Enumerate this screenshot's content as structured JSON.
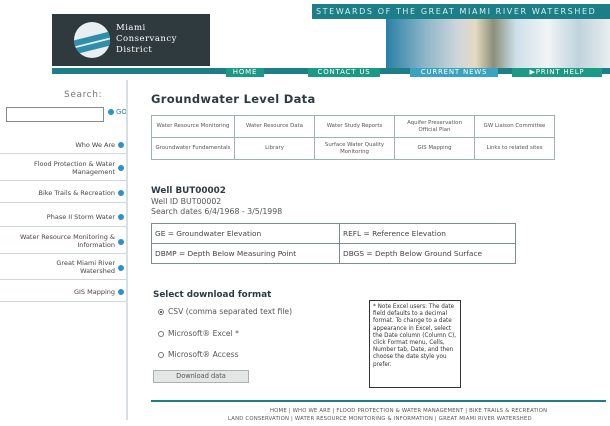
{
  "header": {
    "tagline": "STEWARDS OF THE GREAT MIAMI RIVER WATERSHED",
    "logo_lines": [
      "Miami",
      "Conservancy",
      "District"
    ],
    "nav": [
      "HOME",
      "CONTACT US",
      "CURRENT NEWS",
      "▶PRINT HELP"
    ]
  },
  "sidebar": {
    "search_label": "Search:",
    "search_value": "",
    "go_label": "GO",
    "items": [
      "Who We Are",
      "Flood Protection & Water Management",
      "Bike Trails & Recreation",
      "Phase II Storm Water",
      "Water Resource Monitoring & Information",
      "Great Miami River Watershed",
      "GIS Mapping"
    ]
  },
  "main": {
    "title": "Groundwater Level Data",
    "link_grid": [
      [
        "Water Resource Monitoring",
        "Water Resource Data",
        "Water Study Reports",
        "Aquifer Preservation Official Plan",
        "GW Liaison Committee"
      ],
      [
        "Groundwater Fundamentals",
        "Library",
        "Surface Water Quality Monitoring",
        "GIS Mapping",
        "Links to related sites"
      ]
    ],
    "well_name": "Well BUT00002",
    "well_id": "Well ID BUT00002",
    "search_dates": "Search dates 6/4/1968 - 3/5/1998",
    "legend": [
      [
        "GE = Groundwater Elevation",
        "REFL = Reference Elevation"
      ],
      [
        "DBMP = Depth Below Measuring Point",
        "DBGS = Depth Below Ground Surface"
      ]
    ],
    "download_heading": "Select download format",
    "options": [
      "CSV (comma separated text file)",
      "Microsoft® Excel *",
      "Microsoft® Access"
    ],
    "selected_option": 0,
    "download_button": "Download data",
    "excel_note": "* Note Excel users: The date field defaults to a decimal format. To change to a date appearance in Excel, select the Date column (Column C), click Format menu, Cells, Number tab, Date, and then choose the date style you prefer."
  },
  "footer": {
    "line1": "HOME | WHO WE ARE | FLOOD PROTECTION & WATER MANAGEMENT | BIKE TRAILS & RECREATION",
    "line2": "LAND CONSERVATION | WATER RESOURCE MONITORING & INFORMATION | GREAT MIAMI RIVER WATERSHED"
  },
  "colors": {
    "accent_teal": "#1c7e86",
    "nav_green": "#1c9a86",
    "nav_blue": "#3aa3c0",
    "bullet_blue": "#2f8fc9"
  }
}
